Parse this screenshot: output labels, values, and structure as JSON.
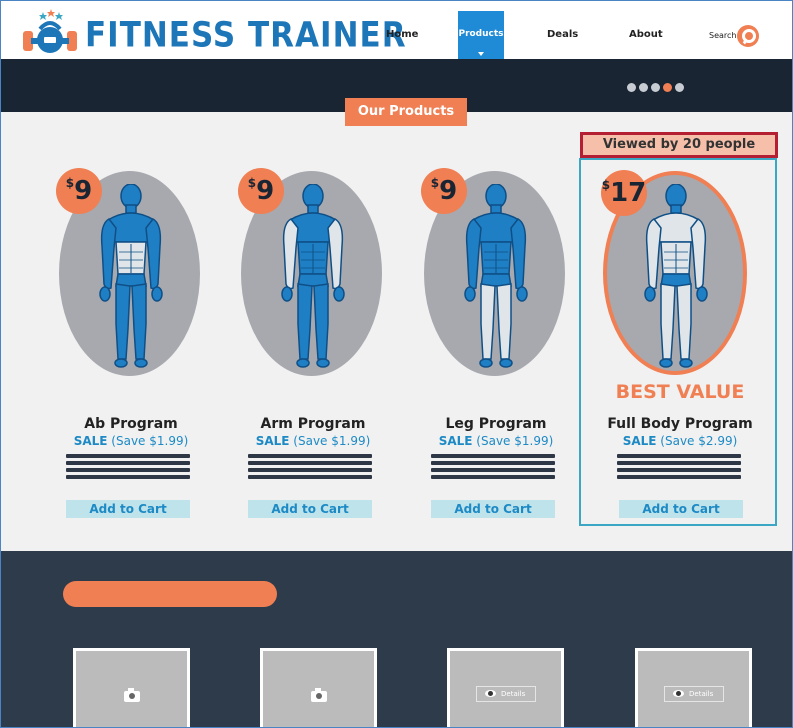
{
  "header": {
    "brand": "FITNESS TRAINER",
    "logo_icon": "kettlebell-logo-icon",
    "nav": {
      "home": "Home",
      "products": "Products",
      "deals": "Deals",
      "about": "About",
      "search": "Search"
    },
    "search_icon": "magnifier-icon"
  },
  "slider": {
    "dots": 5,
    "active_index": 3
  },
  "section_title": "Our Products",
  "products": [
    {
      "currency": "$",
      "price": "9",
      "name": "Ab Program",
      "sale_label": "SALE",
      "sale_text": "(Save $1.99)",
      "cart_label": "Add to Cart",
      "highlight": "abs"
    },
    {
      "currency": "$",
      "price": "9",
      "name": "Arm Program",
      "sale_label": "SALE",
      "sale_text": "(Save $1.99)",
      "cart_label": "Add to Cart",
      "highlight": "arms"
    },
    {
      "currency": "$",
      "price": "9",
      "name": "Leg Program",
      "sale_label": "SALE",
      "sale_text": "(Save $1.99)",
      "cart_label": "Add to Cart",
      "highlight": "legs"
    },
    {
      "currency": "$",
      "price": "17",
      "name": "Full Body Program",
      "sale_label": "SALE",
      "sale_text": "(Save $2.99)",
      "cart_label": "Add to Cart",
      "highlight": "full"
    }
  ],
  "featured": {
    "viewed_text": "Viewed by 20 people",
    "best_value": "BEST VALUE"
  },
  "bottom": {
    "thumbs": [
      {
        "type": "camera",
        "icon": "camera-icon"
      },
      {
        "type": "camera",
        "icon": "camera-icon"
      },
      {
        "type": "details",
        "icon": "eye-icon",
        "label": "Details"
      },
      {
        "type": "details",
        "icon": "eye-icon",
        "label": "Details"
      }
    ]
  },
  "colors": {
    "brand_blue": "#1d76b8",
    "accent_orange": "#f07f53",
    "dark_navy": "#1a2533",
    "slate": "#2e3b4b",
    "muscle_blue": "#1f7fc4",
    "muscle_highlight": "#dfe5e8",
    "highlight_border": "#b51f33"
  }
}
